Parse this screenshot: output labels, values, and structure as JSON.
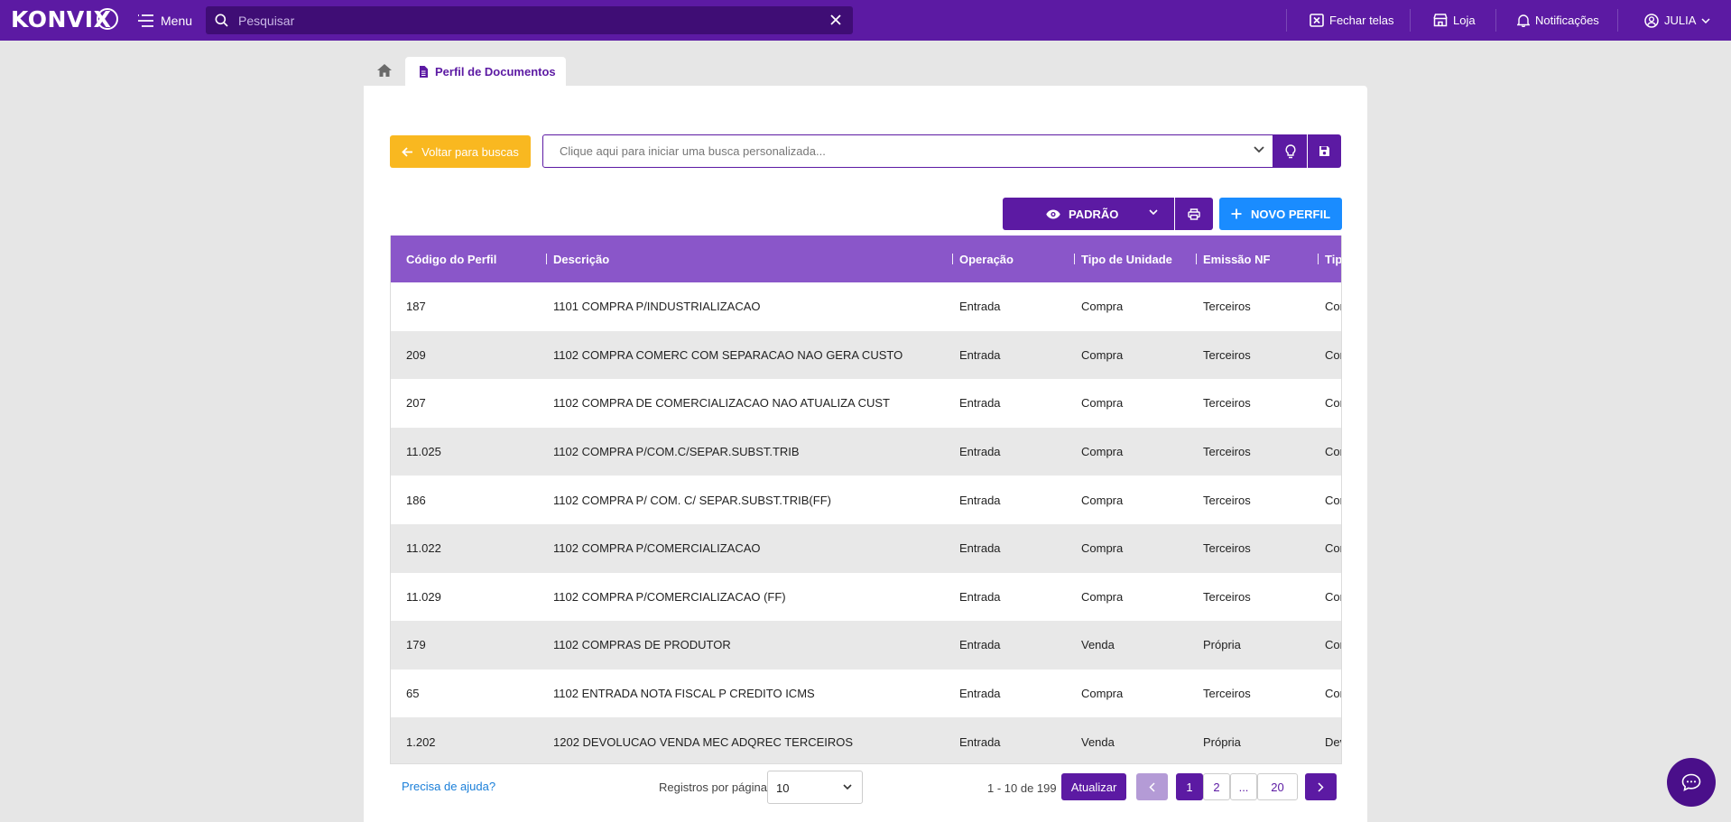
{
  "topbar": {
    "logo": "KONVIX",
    "menu_label": "Menu",
    "search_placeholder": "Pesquisar",
    "nav": {
      "close_screens": "Fechar telas",
      "store": "Loja",
      "notifications": "Notificações",
      "user": "JULIA"
    }
  },
  "tabs": {
    "active_label": "Perfil de Documentos"
  },
  "toolbar": {
    "back_label": "Voltar para buscas",
    "custom_search_placeholder": "Clique aqui para iniciar uma busca personalizada...",
    "view_label": "PADRÃO",
    "new_label": "NOVO PERFIL"
  },
  "table": {
    "columns": [
      "Código do Perfil",
      "Descrição",
      "Operação",
      "Tipo de Unidade",
      "Emissão NF",
      "Tipo"
    ],
    "rows": [
      [
        "187",
        "1101 COMPRA P/INDUSTRIALIZACAO",
        "Entrada",
        "Compra",
        "Terceiros",
        "Compra"
      ],
      [
        "209",
        "1102 COMPRA COMERC COM SEPARACAO NAO GERA CUSTO",
        "Entrada",
        "Compra",
        "Terceiros",
        "Compra"
      ],
      [
        "207",
        "1102 COMPRA DE COMERCIALIZACAO NAO ATUALIZA CUST",
        "Entrada",
        "Compra",
        "Terceiros",
        "Compra"
      ],
      [
        "11.025",
        "1102 COMPRA P/COM.C/SEPAR.SUBST.TRIB",
        "Entrada",
        "Compra",
        "Terceiros",
        "Compra"
      ],
      [
        "186",
        "1102 COMPRA P/ COM. C/ SEPAR.SUBST.TRIB(FF)",
        "Entrada",
        "Compra",
        "Terceiros",
        "Compra"
      ],
      [
        "11.022",
        "1102 COMPRA P/COMERCIALIZACAO",
        "Entrada",
        "Compra",
        "Terceiros",
        "Compra"
      ],
      [
        "11.029",
        "1102 COMPRA P/COMERCIALIZACAO (FF)",
        "Entrada",
        "Compra",
        "Terceiros",
        "Compra"
      ],
      [
        "179",
        "1102 COMPRAS DE PRODUTOR",
        "Entrada",
        "Venda",
        "Própria",
        "Compra"
      ],
      [
        "65",
        "1102 ENTRADA NOTA FISCAL P CREDITO ICMS",
        "Entrada",
        "Compra",
        "Terceiros",
        "Compra"
      ],
      [
        "1.202",
        "1202 DEVOLUCAO VENDA MEC ADQREC TERCEIROS",
        "Entrada",
        "Venda",
        "Própria",
        "Devolução"
      ]
    ]
  },
  "footer": {
    "help_link": "Precisa de ajuda?",
    "rows_per_page_label": "Registros por página",
    "rows_per_page_value": "10",
    "range_text": "1 - 10 de 199",
    "refresh_label": "Atualizar",
    "pages": [
      "1",
      "2",
      "...",
      "20"
    ],
    "current_page": "1"
  },
  "colors": {
    "brand": "#5c1aa3",
    "header_row": "#8a56c9",
    "back_button": "#f9b820",
    "new_button": "#1a8cff",
    "link": "#1a7fd9"
  },
  "icons": [
    "home-icon",
    "document-icon",
    "menu-icon",
    "search-icon",
    "close-icon",
    "fechar-telas-icon",
    "store-icon",
    "bell-icon",
    "user-circle-icon",
    "arrow-left-icon",
    "chevron-down-icon",
    "lightbulb-icon",
    "save-icon",
    "eye-icon",
    "print-icon",
    "plus-icon",
    "chevron-left-icon",
    "chevron-right-icon",
    "chat-icon"
  ]
}
